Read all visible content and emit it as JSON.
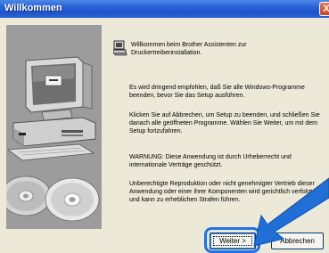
{
  "window": {
    "title": "Willkommen",
    "close_label": "X"
  },
  "message": {
    "welcome": "Willkommen beim Brother Assistenten zur Druckertreiberinstallation.",
    "p1": "Es wird dringend empfohlen, daß Sie alle Windows-Programme beenden, bevor Sie das Setup ausführen.",
    "p2": "Klicken Sie auf Abbrechen, um Setup zu beenden, und schließen Sie danach alle geöffneten Programme. Wählen Sie Weiter, um mit dem Setup fortzufahren.",
    "p3": "WARNUNG: Diese Anwendung ist durch Urheberrecht und internationale Verträge geschützt.",
    "p4": "Unberechtigte Reproduktion oder nicht genehmigter Vertrieb dieser Anwendung oder einer ihrer Komponenten wird gerichtlich verfolgt und kann zu erheblichen Strafen führen."
  },
  "buttons": {
    "next_label": "Weiter >",
    "cancel_label": "Abbrechen"
  },
  "colors": {
    "titlebar": "#2a62d8",
    "arrow": "#1f6fd6",
    "highlight": "#1e73e8"
  }
}
